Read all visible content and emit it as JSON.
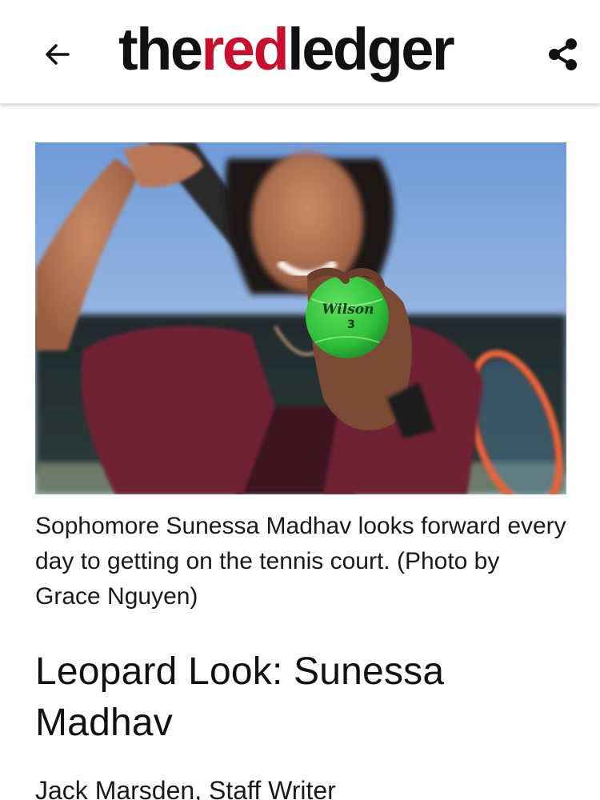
{
  "header": {
    "masthead": {
      "part1": "the",
      "part2": "red",
      "part3": "ledger"
    },
    "back_icon": "arrow-left-icon",
    "share_icon": "share-icon"
  },
  "colors": {
    "brand_red": "#c8102e",
    "text": "#111111",
    "background": "#ffffff"
  },
  "article": {
    "photo_caption": "Sophomore Sunessa Madhav looks forward every day to getting on the tennis court. (Photo by Grace Nguyen)",
    "ball_brand": "Wilson",
    "ball_number": "3",
    "headline": "Leopard Look: Sunessa Madhav",
    "byline": "Jack Marsden, Staff Writer"
  }
}
